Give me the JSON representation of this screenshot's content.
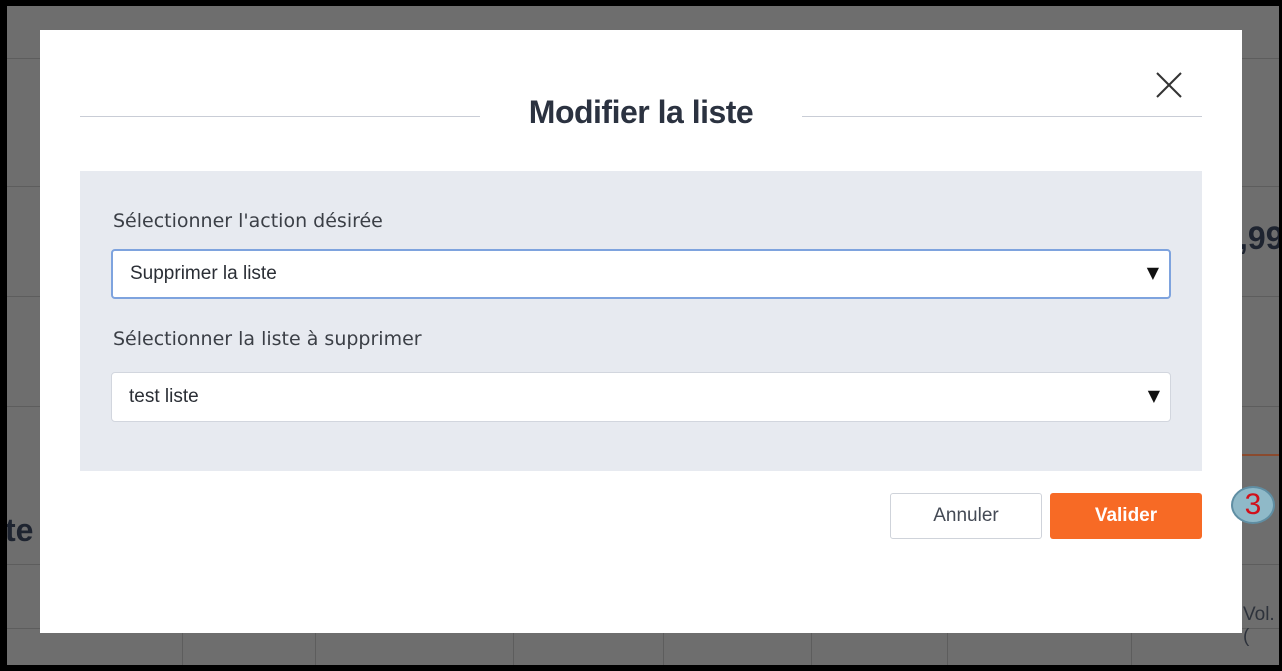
{
  "background": {
    "value_fragment": ",99",
    "heading_fragment": "te",
    "column_fragment": "Vol.("
  },
  "modal": {
    "title": "Modifier la liste",
    "close_glyph": "×",
    "action_label": "Sélectionner l'action désirée",
    "action_value": "Supprimer la liste",
    "list_label": "Sélectionner la liste à  supprimer",
    "list_value": "test liste",
    "caret": "▼",
    "cancel_label": "Annuler",
    "confirm_label": "Valider"
  },
  "annotation": {
    "step": "3"
  },
  "colors": {
    "accent": "#f76a25",
    "panel": "#e7eaf0",
    "overlay": "#6e6e6e"
  }
}
